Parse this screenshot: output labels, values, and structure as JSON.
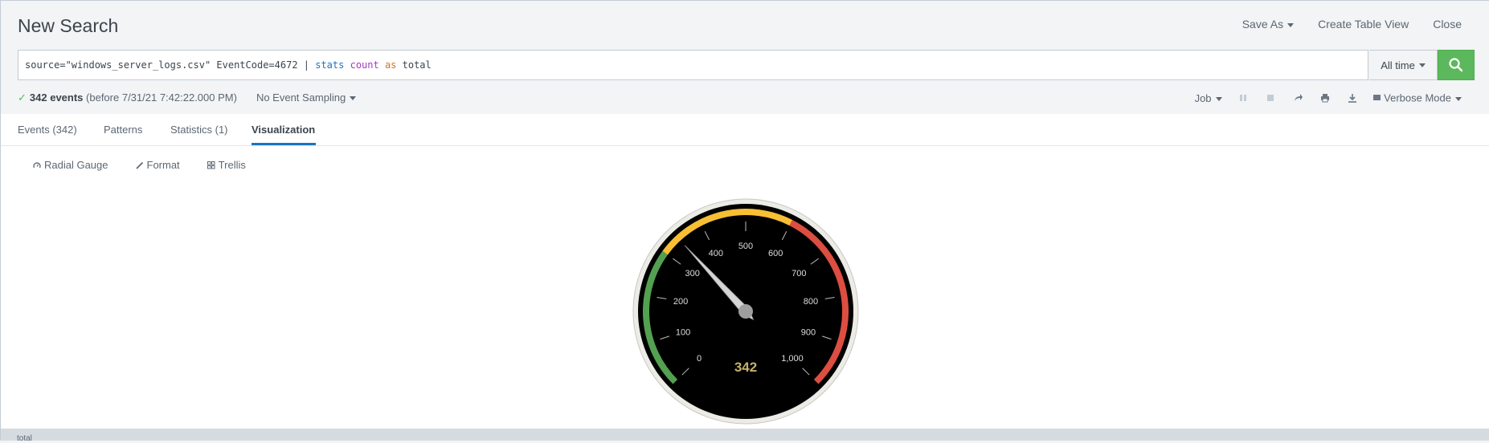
{
  "header": {
    "title": "New Search",
    "actions": {
      "save_as": "Save As",
      "create_table_view": "Create Table View",
      "close": "Close"
    }
  },
  "search": {
    "query_parts": {
      "p1": "source=\"windows_server_logs.csv\" EventCode=4672 | ",
      "stats": "stats",
      "sp1": " ",
      "count": "count",
      "sp2": " ",
      "as": "as",
      "rest": " total"
    },
    "time_range": "All time",
    "search_icon": "magnifier-icon"
  },
  "status": {
    "events_count": "342 events",
    "events_suffix": "(before 7/31/21 7:42:22.000 PM)",
    "sampling": "No Event Sampling",
    "job": "Job",
    "mode": "Verbose Mode"
  },
  "tabs": [
    {
      "label": "Events (342)"
    },
    {
      "label": "Patterns"
    },
    {
      "label": "Statistics (1)"
    },
    {
      "label": "Visualization",
      "active": true
    }
  ],
  "viz_tools": {
    "type": "Radial Gauge",
    "format": "Format",
    "trellis": "Trellis"
  },
  "gauge": {
    "value": 342,
    "display": "342",
    "min": 0,
    "max": 1000,
    "ticks": [
      "0",
      "100",
      "200",
      "300",
      "400",
      "500",
      "600",
      "700",
      "800",
      "900",
      "1,000"
    ],
    "bands": [
      {
        "from": 0,
        "to": 300,
        "color": "#53a051"
      },
      {
        "from": 300,
        "to": 600,
        "color": "#f8be34"
      },
      {
        "from": 600,
        "to": 1000,
        "color": "#dc4e41"
      }
    ],
    "value_color": "#c5b26a"
  },
  "footer": {
    "label": "total"
  },
  "colors": {
    "accent": "#1a73c9",
    "search_button": "#5cb85c"
  }
}
